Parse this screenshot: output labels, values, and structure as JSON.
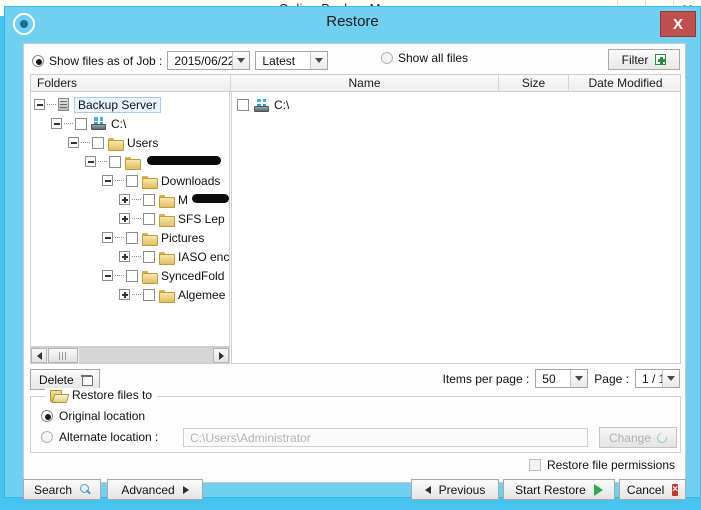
{
  "background_window": {
    "title": "Online Backup Manager",
    "controls": {
      "minimize": "minimize",
      "maximize": "maximize",
      "close": "X"
    }
  },
  "dialog": {
    "title": "Restore",
    "close_label": "X",
    "app_icon": "target-icon"
  },
  "toolbar": {
    "show_as_of_job_label": "Show files as of Job :",
    "job_date": "2015/06/22",
    "job_version": "Latest",
    "show_all_files_label": "Show all files",
    "filter_label": "Filter",
    "show_as_of_job_selected": true,
    "show_all_files_selected": false
  },
  "columns": {
    "folders": "Folders",
    "name": "Name",
    "size": "Size",
    "date_modified": "Date Modified"
  },
  "tree": {
    "nodes": [
      {
        "label": "Backup Server",
        "depth": 0,
        "expander": "minus",
        "checkbox": false,
        "icon": "server-plain-icon",
        "selected": true,
        "has_checkbox": false
      },
      {
        "label": "C:\\",
        "depth": 1,
        "expander": "minus",
        "checkbox": false,
        "icon": "drive-icon",
        "selected": false,
        "has_checkbox": true
      },
      {
        "label": "Users",
        "depth": 2,
        "expander": "minus",
        "checkbox": false,
        "icon": "folder-icon",
        "selected": false,
        "has_checkbox": true
      },
      {
        "label": "",
        "redacted": true,
        "depth": 3,
        "expander": "minus",
        "checkbox": false,
        "icon": "folder-icon",
        "selected": false,
        "has_checkbox": true
      },
      {
        "label": "Downloads",
        "depth": 4,
        "expander": "minus",
        "checkbox": false,
        "icon": "folder-icon",
        "selected": false,
        "has_checkbox": true
      },
      {
        "label": "M",
        "redacted_partial": true,
        "depth": 5,
        "expander": "plus",
        "checkbox": false,
        "icon": "folder-icon",
        "selected": false,
        "has_checkbox": true
      },
      {
        "label": "SFS Lep",
        "depth": 5,
        "expander": "plus",
        "checkbox": false,
        "icon": "folder-icon",
        "selected": false,
        "has_checkbox": true
      },
      {
        "label": "Pictures",
        "depth": 4,
        "expander": "minus",
        "checkbox": false,
        "icon": "folder-icon",
        "selected": false,
        "has_checkbox": true
      },
      {
        "label": "IASO enc",
        "depth": 5,
        "expander": "plus",
        "checkbox": false,
        "icon": "folder-icon",
        "selected": false,
        "has_checkbox": true
      },
      {
        "label": "SyncedFold",
        "depth": 4,
        "expander": "minus",
        "checkbox": false,
        "icon": "folder-icon",
        "selected": false,
        "has_checkbox": true
      },
      {
        "label": "Algemee",
        "depth": 5,
        "expander": "plus",
        "checkbox": false,
        "icon": "folder-icon",
        "selected": false,
        "has_checkbox": true
      }
    ]
  },
  "file_list": {
    "rows": [
      {
        "name": "C:\\",
        "size": "",
        "date_modified": "",
        "checked": false,
        "icon": "drive-icon"
      }
    ]
  },
  "paging": {
    "delete_label": "Delete",
    "items_per_page_label": "Items per page :",
    "items_per_page_value": "50",
    "page_label": "Page :",
    "page_value": "1 / 1"
  },
  "restore_target": {
    "group_label": "Restore files to",
    "original_location_label": "Original location",
    "original_selected": true,
    "alternate_location_label": "Alternate location :",
    "alternate_selected": false,
    "alternate_path_placeholder": "C:\\Users\\Administrator",
    "change_label": "Change"
  },
  "permissions": {
    "restore_file_permissions_label": "Restore file permissions",
    "checked": false
  },
  "buttons": {
    "search": "Search",
    "advanced": "Advanced",
    "previous": "Previous",
    "start_restore": "Start Restore",
    "cancel": "Cancel"
  },
  "colors": {
    "dialog_header": "#6fd0f2",
    "close_button": "#c0504d",
    "accent_green": "#2fa84f",
    "selection": "#eaf4fd"
  }
}
